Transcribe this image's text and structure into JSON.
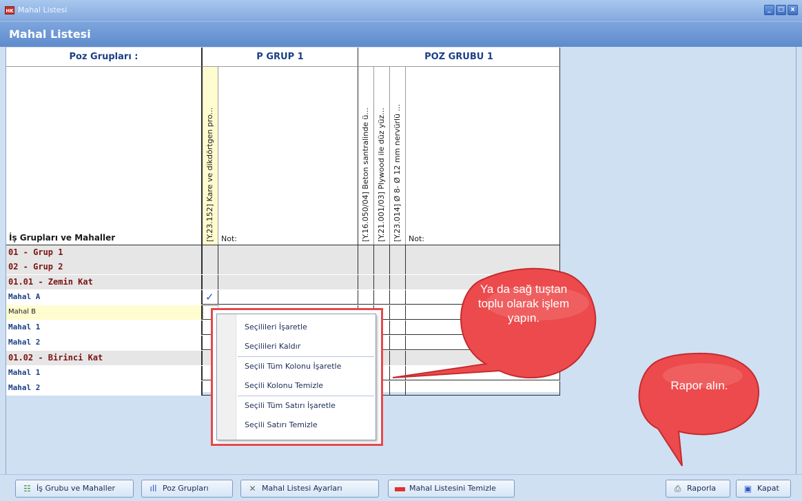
{
  "window": {
    "app_icon": "HK",
    "title": "Mahal Listesi",
    "controls": [
      "_",
      "□",
      "x"
    ]
  },
  "header": {
    "title": "Mahal Listesi"
  },
  "grid": {
    "col_headers": [
      "Poz Grupları :",
      "P GRUP 1",
      "POZ GRUBU 1"
    ],
    "row_header_title": "İş Grupları ve Mahaller",
    "vertical_columns": [
      "[Y.23.152] Kare ve dikdörtgen pro...",
      "[Y.16.050/04] Beton santralinde ü...",
      "[Y.21.001/03] Plywood ile düz yüz...",
      "[Y.23.014] Ø 8- Ø 12 mm nervürlü ..."
    ],
    "not_label": "Not:",
    "rows": [
      {
        "label": "01 - Grup 1",
        "kind": "grp"
      },
      {
        "label": "02 - Grup 2",
        "kind": "grp"
      },
      {
        "label": "01.01 - Zemin Kat",
        "kind": "grp"
      },
      {
        "label": "Mahal A",
        "kind": "item",
        "checked": "✓"
      },
      {
        "label": "Mahal B",
        "kind": "sel"
      },
      {
        "label": "Mahal 1",
        "kind": "item"
      },
      {
        "label": "Mahal 2",
        "kind": "item"
      },
      {
        "label": "01.02 - Birinci Kat",
        "kind": "grp"
      },
      {
        "label": "Mahal 1",
        "kind": "item"
      },
      {
        "label": "Mahal 2",
        "kind": "item"
      }
    ]
  },
  "context_menu": {
    "items": [
      "Seçilileri İşaretle",
      "Seçilileri Kaldır",
      "Seçili Tüm Kolonu İşaretle",
      "Seçili Kolonu Temizle",
      "Seçili Tüm Satırı İşaretle",
      "Seçili Satırı Temizle"
    ]
  },
  "callouts": {
    "right_click_tip": "Ya da sağ tuştan toplu olarak işlem yapın.",
    "report_tip": "Rapor alın."
  },
  "toolbar": {
    "is_grubu": "İş Grubu ve Mahaller",
    "poz_gruplari": "Poz Grupları",
    "ayarlar": "Mahal Listesi Ayarları",
    "temizle": "Mahal Listesini Temizle",
    "raporla": "Raporla",
    "kapat": "Kapat"
  },
  "colors": {
    "accent": "#5f8bcc",
    "callout": "#e5484b",
    "group_text": "#7c1414",
    "item_text": "#1c3f86"
  }
}
